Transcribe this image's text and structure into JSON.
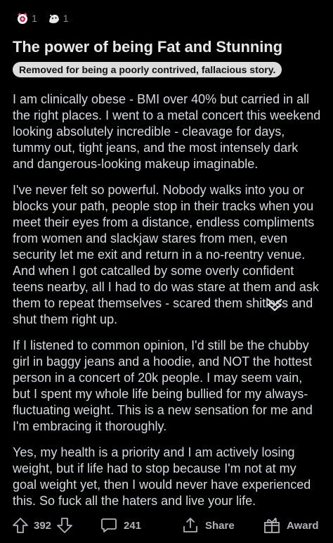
{
  "awards": [
    {
      "icon": "gem-award-icon",
      "count": "1"
    },
    {
      "icon": "wholesome-award-icon",
      "count": "1"
    }
  ],
  "post": {
    "title": "The power of being Fat and Stunning",
    "flair": "Removed for being a poorly contrived, fallacious story.",
    "paragraphs": [
      "I am clinically obese - BMI over 40% but carried in all the right places. I went to a metal concert this weekend looking absolutely incredible - cleavage for days, tummy out, tight jeans, and the most intensely dark and dangerous-looking makeup imaginable.",
      "I've never felt so powerful. Nobody walks into you or blocks your path, people stop in their tracks when you meet their eyes from a distance, endless compliments from women and slackjaw stares from men, even security let me exit and return in a no-reentry venue. And when I got catcalled by some overly confident teens nearby, all I had to do was stare at them and ask them to repeat themselves - scared them shitless and shut them right up.",
      "If I listened to common opinion, I'd still be the chubby girl in baggy jeans and a hoodie, and NOT the hottest person in a concert of 20k people. I may seem vain, but I spent my whole life being bullied for my always-fluctuating weight. This is a new sensation for me and I'm embracing it thoroughly.",
      "Yes, my health is a priority and I am actively losing weight, but if life had to stop because I'm not at my goal weight yet, then I would never have experienced this. So fuck all the haters and live your life."
    ]
  },
  "actions": {
    "votes": "392",
    "comments": "241",
    "share_label": "Share",
    "award_label": "Award"
  }
}
